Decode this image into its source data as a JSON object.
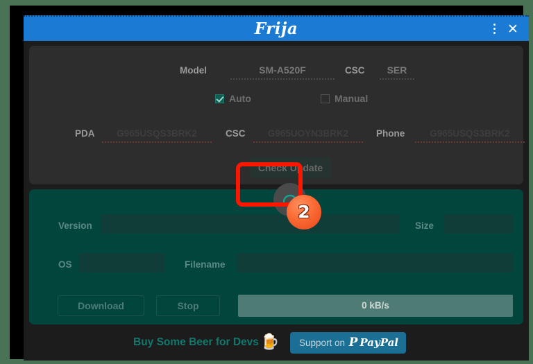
{
  "window": {
    "title": "Frija",
    "menu_icon": "kebab-menu-icon",
    "close_icon": "close-icon"
  },
  "model_panel": {
    "model_label": "Model",
    "model_value": "SM-A520F",
    "csc_label": "CSC",
    "csc_value": "SER",
    "auto_label": "Auto",
    "auto_checked": true,
    "manual_label": "Manual",
    "manual_checked": false,
    "firmware": [
      {
        "label": "PDA",
        "value": "G965USQS3BRK2"
      },
      {
        "label": "CSC",
        "value": "G965UOYN3BRK2"
      },
      {
        "label": "Phone",
        "value": "G965USQS3BRK2"
      }
    ],
    "check_update_label": "Check Update"
  },
  "spinner": {
    "name": "loading-spinner",
    "color": "#19a08e"
  },
  "download_panel": {
    "version_label": "Version",
    "version_value": "",
    "size_label": "Size",
    "size_value": "",
    "os_label": "OS",
    "os_value": "",
    "filename_label": "Filename",
    "filename_value": "",
    "download_label": "Download",
    "stop_label": "Stop",
    "speed_text": "0 kB/s"
  },
  "footer": {
    "beer_text": "Buy Some Beer for Devs",
    "beer_icon": "🍺",
    "paypal_support_text": "Support on",
    "paypal_mark": "P",
    "paypal_logo_text": "PayPal"
  },
  "annotation": {
    "badge_number": "2",
    "highlight_color": "#f81700",
    "badge_color": "#fa6a33"
  }
}
